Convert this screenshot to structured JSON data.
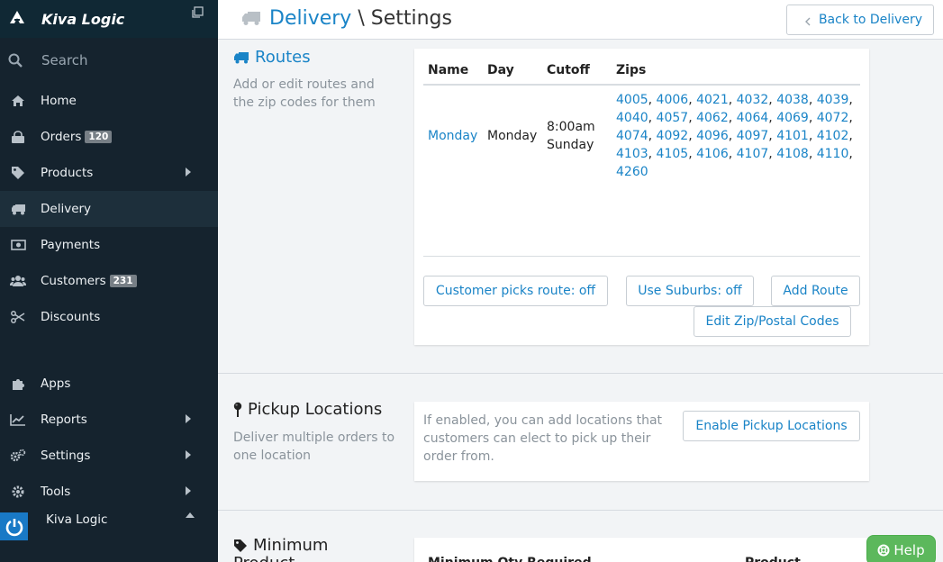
{
  "sidebar": {
    "brand": "Kiva Logic",
    "search_label": "Search",
    "items": [
      {
        "label": "Home"
      },
      {
        "label": "Orders",
        "badge": "120"
      },
      {
        "label": "Products"
      },
      {
        "label": "Delivery"
      },
      {
        "label": "Payments"
      },
      {
        "label": "Customers",
        "badge": "231"
      },
      {
        "label": "Discounts"
      },
      {
        "label": "Apps"
      },
      {
        "label": "Reports"
      },
      {
        "label": "Settings"
      },
      {
        "label": "Tools"
      }
    ],
    "user_name": "Kiva Logic"
  },
  "header": {
    "title_link": "Delivery",
    "title_sep": " \\ ",
    "title_rest": "Settings",
    "back_label": "Back to Delivery"
  },
  "routes": {
    "title": "Routes",
    "description": "Add or edit routes and the zip codes for them",
    "columns": [
      "Name",
      "Day",
      "Cutoff",
      "Zips"
    ],
    "row": {
      "name": "Monday",
      "day": "Monday",
      "cutoff_time": "8:00am",
      "cutoff_day": "Sunday",
      "zips": [
        "4005",
        "4006",
        "4021",
        "4032",
        "4038",
        "4039",
        "4040",
        "4057",
        "4062",
        "4064",
        "4069",
        "4072",
        "4074",
        "4092",
        "4096",
        "4097",
        "4101",
        "4102",
        "4103",
        "4105",
        "4106",
        "4107",
        "4108",
        "4110",
        "4260"
      ]
    },
    "buttons": {
      "customer_picks": "Customer picks route: off",
      "use_suburbs": "Use Suburbs: off",
      "add_route": "Add Route",
      "edit_zips": "Edit Zip/Postal Codes"
    }
  },
  "pickup": {
    "title": "Pickup Locations",
    "description": "Deliver multiple orders to one location",
    "info": "If enabled, you can add locations that customers can elect to pick up their order from.",
    "enable_label": "Enable Pickup Locations"
  },
  "minimum": {
    "title": "Minimum",
    "title_line2": "Product",
    "columns": [
      "Minimum Qty Required",
      "Product"
    ]
  },
  "help_label": "Help",
  "colors": {
    "accent": "#1a84c7",
    "sidebar": "#15232e",
    "help": "#5cb85c"
  }
}
